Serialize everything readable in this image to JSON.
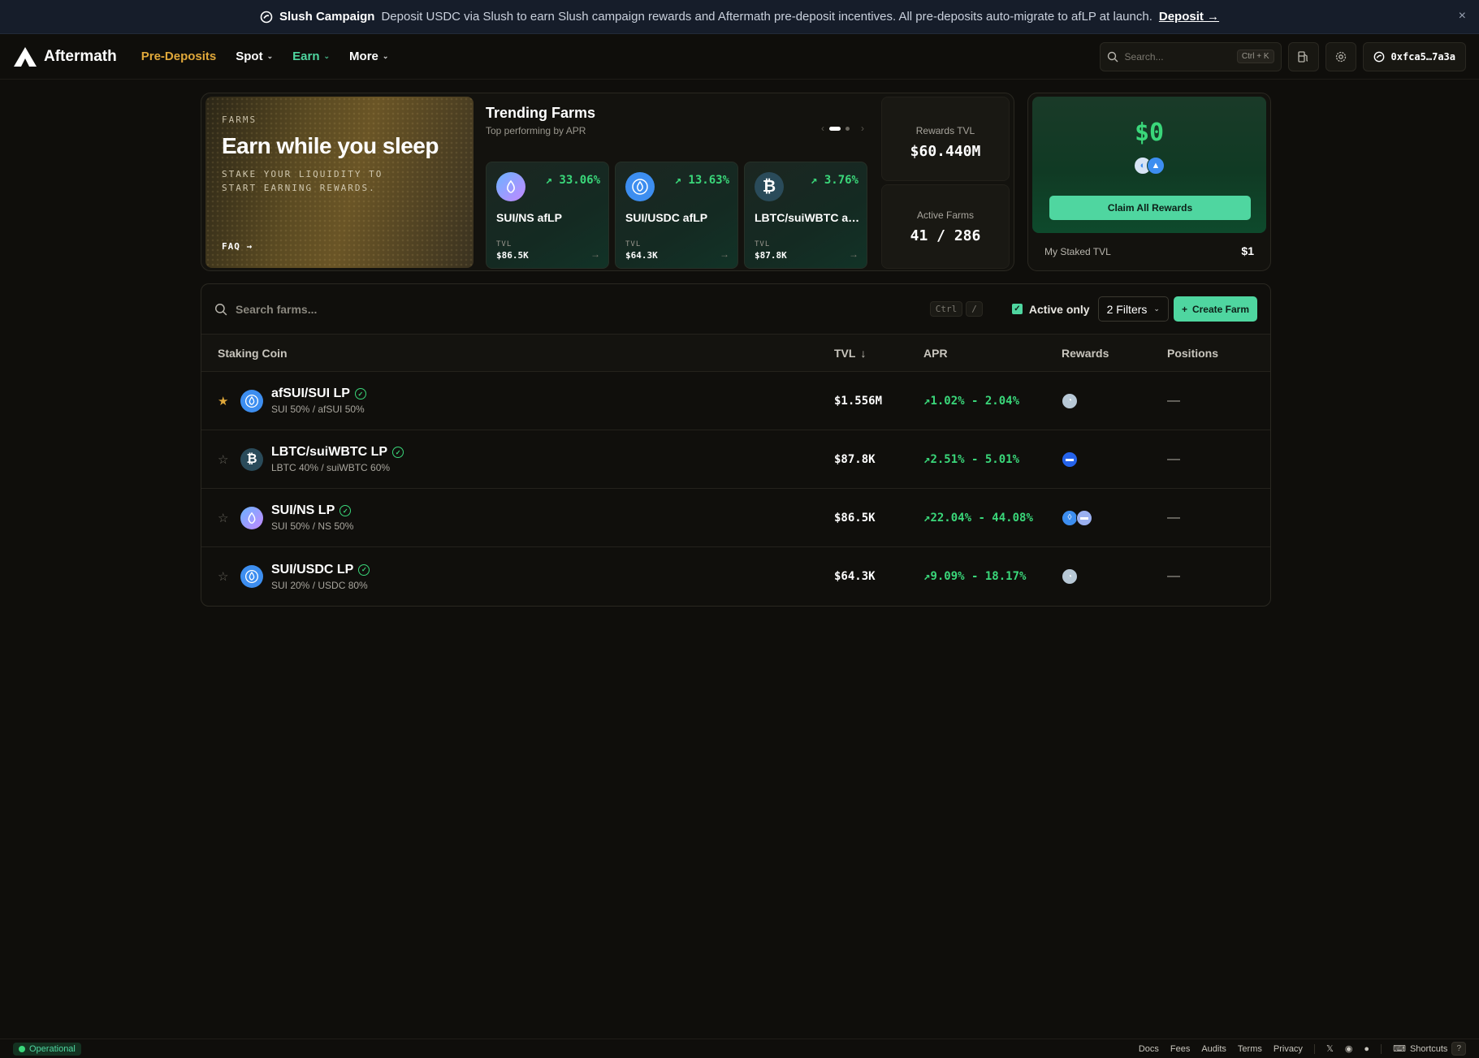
{
  "banner": {
    "title": "Slush Campaign",
    "text": "Deposit USDC via Slush to earn Slush campaign rewards and Aftermath pre-deposit incentives. All pre-deposits auto-migrate to afLP at launch.",
    "link": "Deposit →",
    "close": "×"
  },
  "nav": {
    "logo": "Aftermath",
    "items": [
      "Pre-Deposits",
      "Spot",
      "Earn",
      "More"
    ],
    "search_placeholder": "Search...",
    "search_shortcut": "Ctrl + K",
    "wallet": "0xfca5…7a3a"
  },
  "promo": {
    "kicker": "FARMS",
    "title": "Earn while you sleep",
    "subtitle": "STAKE YOUR LIQUIDITY TO START EARNING REWARDS.",
    "faq": "FAQ →"
  },
  "trending": {
    "title": "Trending Farms",
    "subtitle": "Top performing by APR",
    "tvl_label": "TVL",
    "cards": [
      {
        "name": "SUI/NS afLP",
        "apr": "33.06%",
        "tvl": "$86.5K"
      },
      {
        "name": "SUI/USDC afLP",
        "apr": "13.63%",
        "tvl": "$64.3K"
      },
      {
        "name": "LBTC/suiWBTC af...",
        "apr": "3.76%",
        "tvl": "$87.8K"
      }
    ]
  },
  "stats": {
    "rewards_tvl_label": "Rewards TVL",
    "rewards_tvl": "$60.440M",
    "active_farms_label": "Active Farms",
    "active_farms": "41 / 286"
  },
  "rewards": {
    "amount": "$0",
    "claim": "Claim All Rewards",
    "staked_label": "My Staked TVL",
    "staked_value": "$1"
  },
  "toolbar": {
    "search_placeholder": "Search farms...",
    "kbd_ctrl": "Ctrl",
    "kbd_slash": "/",
    "active_only": "Active only",
    "filters": "2 Filters",
    "create": "Create Farm"
  },
  "table": {
    "columns": [
      "Staking Coin",
      "TVL",
      "APR",
      "Rewards",
      "Positions"
    ],
    "rows": [
      {
        "name": "afSUI/SUI LP",
        "sub": "SUI 50% / afSUI 50%",
        "tvl": "$1.556M",
        "apr": "1.02% - 2.04%",
        "pos": "—",
        "starred": true
      },
      {
        "name": "LBTC/suiWBTC LP",
        "sub": "LBTC 40% / suiWBTC 60%",
        "tvl": "$87.8K",
        "apr": "2.51% - 5.01%",
        "pos": "—",
        "starred": false
      },
      {
        "name": "SUI/NS LP",
        "sub": "SUI 50% / NS 50%",
        "tvl": "$86.5K",
        "apr": "22.04% - 44.08%",
        "pos": "—",
        "starred": false
      },
      {
        "name": "SUI/USDC LP",
        "sub": "SUI 20% / USDC 80%",
        "tvl": "$64.3K",
        "apr": "9.09% - 18.17%",
        "pos": "—",
        "starred": false
      }
    ]
  },
  "footer": {
    "status": "Operational",
    "links": [
      "Docs",
      "Fees",
      "Audits",
      "Terms",
      "Privacy"
    ],
    "shortcuts": "Shortcuts",
    "shortcuts_key": "?"
  }
}
